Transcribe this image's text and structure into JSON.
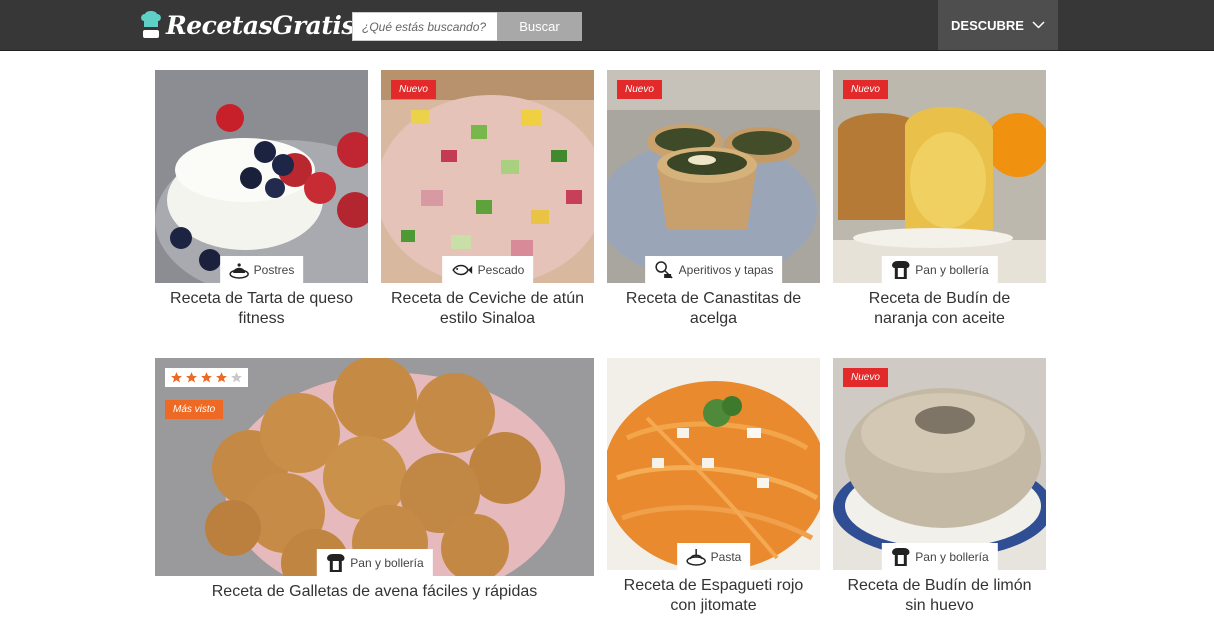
{
  "header": {
    "logo_text": "RecetasGratis",
    "search_placeholder": "¿Qué estás buscando?",
    "search_button": "Buscar",
    "discover": "DESCUBRE"
  },
  "badges": {
    "new": "Nuevo",
    "most_viewed": "Más visto"
  },
  "recipes": [
    {
      "title": "Receta de Tarta de queso fitness",
      "category": "Postres",
      "category_icon": "dessert-icon",
      "new": false
    },
    {
      "title": "Receta de Ceviche de atún estilo Sinaloa",
      "category": "Pescado",
      "category_icon": "fish-icon",
      "new": true
    },
    {
      "title": "Receta de Canastitas de acelga",
      "category": "Aperitivos y tapas",
      "category_icon": "appetizer-icon",
      "new": true
    },
    {
      "title": "Receta de Budín de naranja con aceite",
      "category": "Pan y bollería",
      "category_icon": "bread-icon",
      "new": true
    },
    {
      "title": "Receta de Galletas de avena fáciles y rápidas",
      "category": "Pan y bollería",
      "category_icon": "bread-icon",
      "new": false,
      "rating": 4,
      "rating_max": 5,
      "most_viewed": true
    },
    {
      "title": "Receta de Espagueti rojo con jitomate",
      "category": "Pasta",
      "category_icon": "pasta-icon",
      "new": false
    },
    {
      "title": "Receta de Budín de limón sin huevo",
      "category": "Pan y bollería",
      "category_icon": "bread-icon",
      "new": true
    }
  ],
  "colors": {
    "header_bg": "#373737",
    "discover_bg": "#4e4e4e",
    "new_badge": "#e22a2a",
    "most_viewed_badge": "#ee6a24",
    "star": "#ee6a24",
    "logo_accent": "#5fd0c6"
  }
}
